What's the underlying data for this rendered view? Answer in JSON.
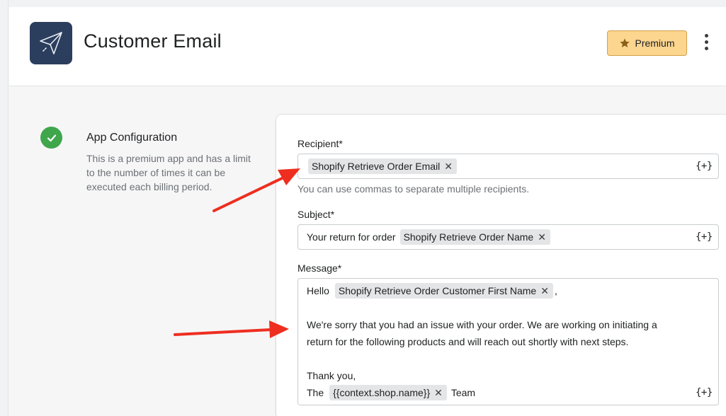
{
  "header": {
    "title": "Customer Email",
    "premium_label": "Premium"
  },
  "sidebar": {
    "section_title": "App Configuration",
    "section_description": "This is a premium app and has a limit to the number of times it can be executed each billing period."
  },
  "form": {
    "recipient": {
      "label": "Recipient*",
      "tags": [
        "Shopify Retrieve Order Email"
      ],
      "help": "You can use commas to separate multiple recipients.",
      "var_button": "{+}"
    },
    "subject": {
      "label": "Subject*",
      "prefix": "Your return for order",
      "tags": [
        "Shopify Retrieve Order Name"
      ],
      "var_button": "{+}"
    },
    "message": {
      "label": "Message*",
      "line1_prefix": "Hello",
      "line1_tag": "Shopify Retrieve Order Customer First Name",
      "line1_suffix": ",",
      "line2": "We're sorry that you had an issue with your order. We are working on initiating a",
      "line3": "return for the following products and will reach out shortly with next steps.",
      "line4": "Thank you,",
      "line5_prefix": "The",
      "line5_tag": "{{context.shop.name}}",
      "line5_suffix": "Team",
      "var_button": "{+}"
    }
  },
  "icons": {
    "app_icon": "paper-plane-icon",
    "premium_icon": "star-icon",
    "more_icon": "vertical-dots-icon",
    "status_icon": "check-icon",
    "remove_icon": "close-icon"
  },
  "colors": {
    "app_icon_bg": "#2c3e5d",
    "premium_bg": "#fcd58f",
    "success_green": "#3fa64b",
    "annotation_arrow": "#ee2e1f"
  }
}
